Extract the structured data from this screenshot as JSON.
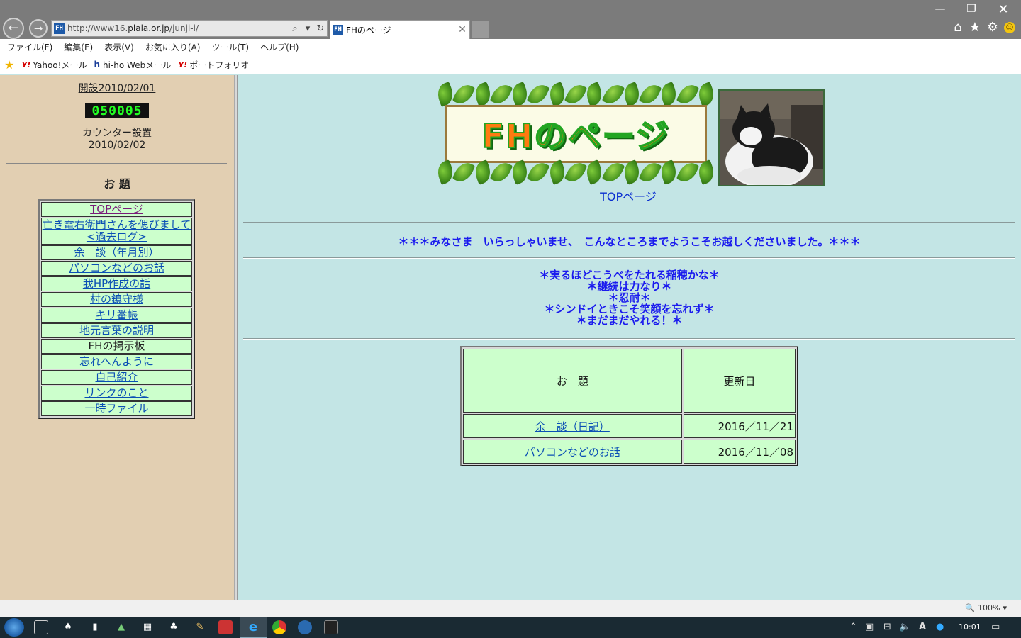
{
  "browser": {
    "url_prefix": "http://www16.",
    "url_domain": "plala.or.jp",
    "url_path": "/junji-i/",
    "tab_title": "FHのページ",
    "favicon_text": "FH",
    "menu": [
      "ファイル(F)",
      "編集(E)",
      "表示(V)",
      "お気に入り(A)",
      "ツール(T)",
      "ヘルプ(H)"
    ],
    "favorites": [
      {
        "icon": "Y!",
        "label": "Yahoo!メール"
      },
      {
        "icon": "h",
        "label": "hi-ho Webメール"
      },
      {
        "icon": "Y!",
        "label": "ポートフォリオ"
      }
    ],
    "zoom": "100%"
  },
  "left": {
    "opened": "開設2010/02/01",
    "counter": "050005",
    "counter_label_1": "カウンター設置",
    "counter_label_2": "2010/02/02",
    "heading": "お 題",
    "menu": [
      "TOPページ",
      "亡き電右衛門さんを偲びまして",
      "<過去ログ>",
      "余　談（年月別）",
      "パソコンなどのお話",
      "我HP作成の話",
      "村の鎮守様",
      "キリ番帳",
      "地元言葉の説明",
      "FHの掲示板",
      "忘れへんように",
      "自己紹介",
      "リンクのこと",
      "一時ファイル"
    ]
  },
  "right": {
    "banner_title": "FHのページ",
    "top_link": "TOPページ",
    "welcome": "＊＊＊みなさま　いらっしゃいませ、　こんなところまでようこそお越しくださいました。＊＊＊",
    "mottos": [
      "＊実るほどこうべをたれる稲穂かな＊",
      "＊継続は力なり＊",
      "＊忍耐＊",
      "＊シンドイときこそ笑顔を忘れず＊",
      "＊まだまだやれる！＊"
    ],
    "table": {
      "col_title": "お　題",
      "col_date": "更新日",
      "rows": [
        {
          "title": "余　談（日記）",
          "date": "2016／11／21"
        },
        {
          "title": "パソコンなどのお話",
          "date": "2016／11／08"
        }
      ]
    }
  },
  "taskbar": {
    "clock": "10:01"
  }
}
